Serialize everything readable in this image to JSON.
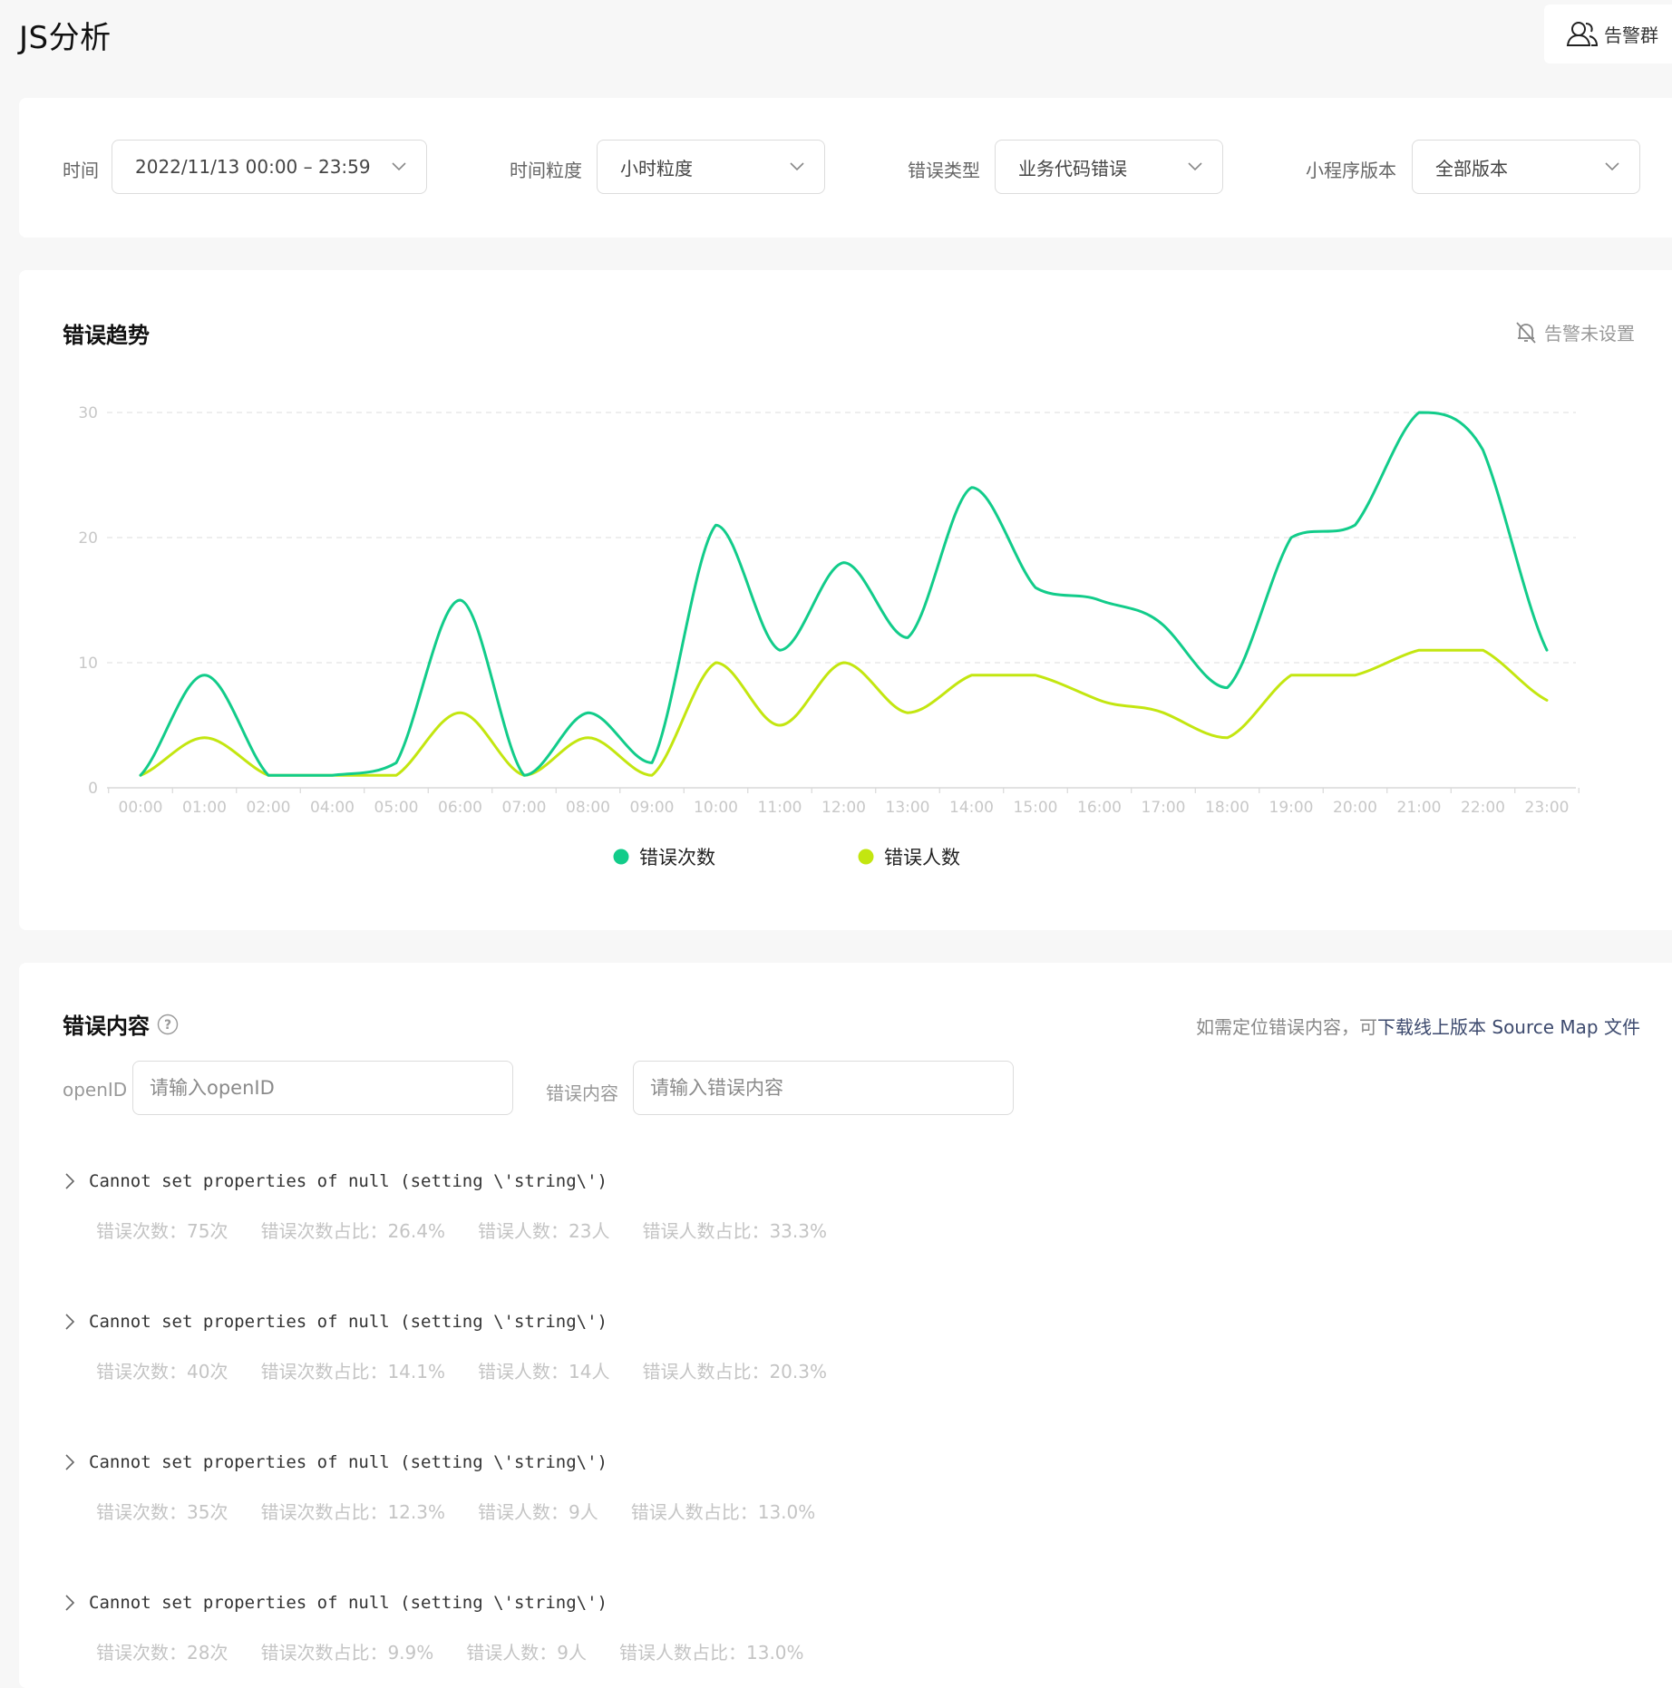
{
  "header": {
    "title": "JS分析",
    "alert_group_label": "告警群"
  },
  "filters": {
    "time": {
      "label": "时间",
      "value": "2022/11/13 00:00 – 23:59"
    },
    "granularity": {
      "label": "时间粒度",
      "value": "小时粒度"
    },
    "error_type": {
      "label": "错误类型",
      "value": "业务代码错误"
    },
    "version": {
      "label": "小程序版本",
      "value": "全部版本"
    }
  },
  "trend": {
    "title": "错误趋势",
    "alert_status": "告警未设置"
  },
  "chart_data": {
    "type": "line",
    "categories": [
      "00:00",
      "01:00",
      "02:00",
      "04:00",
      "05:00",
      "06:00",
      "07:00",
      "08:00",
      "09:00",
      "10:00",
      "11:00",
      "12:00",
      "13:00",
      "14:00",
      "15:00",
      "16:00",
      "17:00",
      "18:00",
      "19:00",
      "20:00",
      "21:00",
      "22:00",
      "23:00"
    ],
    "series": [
      {
        "name": "错误次数",
        "color": "#12cc8a",
        "values": [
          1,
          9,
          1,
          1,
          2,
          15,
          1,
          6,
          2,
          21,
          11,
          18,
          12,
          24,
          16,
          15,
          13,
          8,
          20,
          21,
          30,
          27,
          11
        ]
      },
      {
        "name": "错误人数",
        "color": "#c3e610",
        "values": [
          1,
          4,
          1,
          1,
          1,
          6,
          1,
          4,
          1,
          10,
          5,
          10,
          6,
          9,
          9,
          7,
          6,
          4,
          9,
          9,
          11,
          11,
          7
        ]
      }
    ],
    "ylim": [
      0,
      30
    ],
    "yticks": [
      0,
      10,
      20,
      30
    ],
    "grid": true,
    "legend_position": "bottom"
  },
  "content": {
    "title": "错误内容",
    "hint_prefix": "如需定位错误内容，可",
    "hint_link": "下载线上版本 Source Map 文件",
    "openid": {
      "label": "openID",
      "placeholder": "请输入openID"
    },
    "keyword": {
      "label": "错误内容",
      "placeholder": "请输入错误内容"
    },
    "errors": [
      {
        "message": "Cannot set properties of null (setting \\'string\\')",
        "count": "错误次数：75次",
        "count_ratio": "错误次数占比：26.4%",
        "users": "错误人数：23人",
        "users_ratio": "错误人数占比：33.3%"
      },
      {
        "message": "Cannot set properties of null (setting \\'string\\')",
        "count": "错误次数：40次",
        "count_ratio": "错误次数占比：14.1%",
        "users": "错误人数：14人",
        "users_ratio": "错误人数占比：20.3%"
      },
      {
        "message": "Cannot set properties of null (setting \\'string\\')",
        "count": "错误次数：35次",
        "count_ratio": "错误次数占比：12.3%",
        "users": "错误人数：9人",
        "users_ratio": "错误人数占比：13.0%"
      },
      {
        "message": "Cannot set properties of null (setting \\'string\\')",
        "count": "错误次数：28次",
        "count_ratio": "错误次数占比：9.9%",
        "users": "错误人数：9人",
        "users_ratio": "错误人数占比：13.0%"
      }
    ]
  }
}
